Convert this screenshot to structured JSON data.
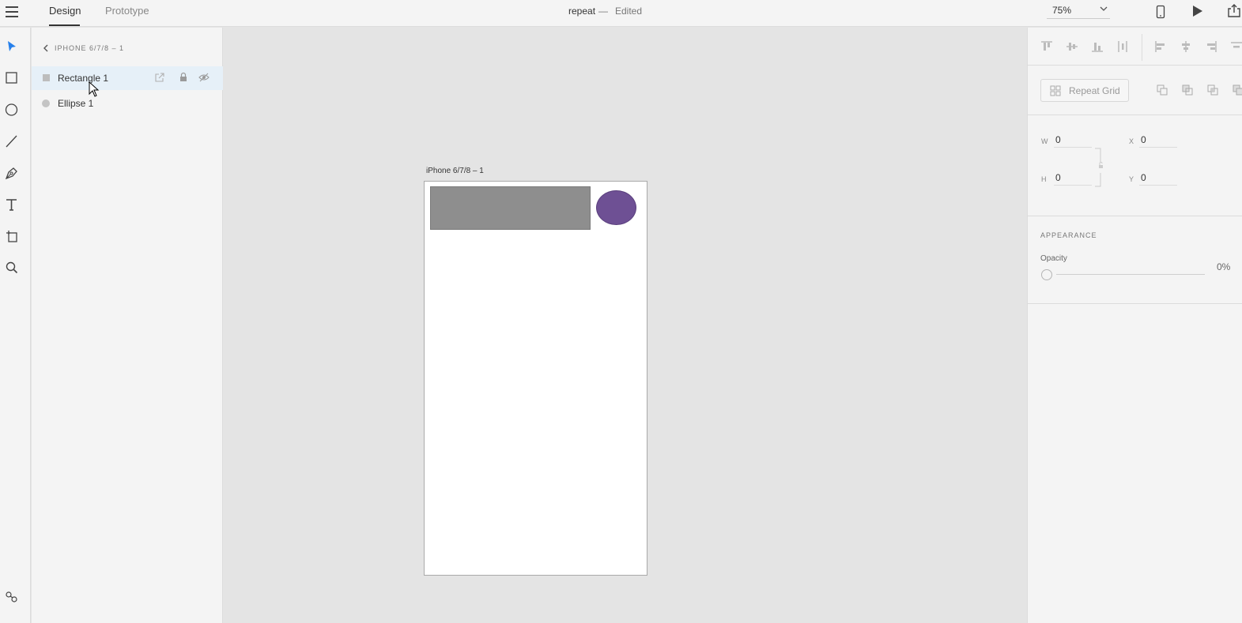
{
  "topbar": {
    "tabs": [
      {
        "label": "Design",
        "active": true
      },
      {
        "label": "Prototype",
        "active": false
      }
    ],
    "document_title": "repeat",
    "separator": "—",
    "status": "Edited",
    "zoom": "75%"
  },
  "toolbar": {
    "tools": [
      "select-tool",
      "rectangle-tool",
      "ellipse-tool",
      "line-tool",
      "pen-tool",
      "text-tool",
      "artboard-tool",
      "zoom-tool"
    ],
    "active_tool": "select-tool",
    "bottom": "plugins-tool"
  },
  "layers": {
    "breadcrumb": "IPHONE 6/7/8 – 1",
    "items": [
      {
        "name": "Rectangle 1",
        "type": "rectangle",
        "selected": true
      },
      {
        "name": "Ellipse 1",
        "type": "ellipse",
        "selected": false
      }
    ]
  },
  "canvas": {
    "artboard_label": "iPhone 6/7/8 – 1",
    "rectangle_color": "#8e8e8e",
    "ellipse_color": "#6e5094"
  },
  "inspector": {
    "repeat_grid_label": "Repeat Grid",
    "w_label": "W",
    "w_value": "0",
    "h_label": "H",
    "h_value": "0",
    "x_label": "X",
    "x_value": "0",
    "y_label": "Y",
    "y_value": "0",
    "appearance_title": "APPEARANCE",
    "opacity_label": "Opacity",
    "opacity_value": "0%"
  },
  "colors": {
    "accent": "#2680eb",
    "selected_row": "#e6f0f8"
  }
}
